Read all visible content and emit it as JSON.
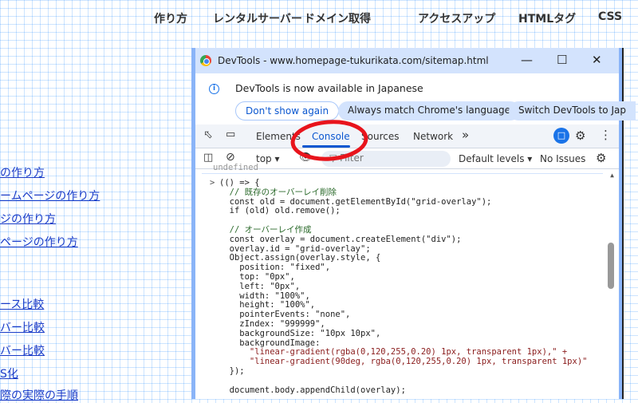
{
  "nav": [
    "作り方",
    "レンタルサーバー",
    "ドメイン取得",
    "アクセスアップ",
    "HTMLタグ",
    "CSS"
  ],
  "links": [
    "の作り方",
    "ームページの作り方",
    "ジの作り方",
    "ページの作り方",
    "ース比較",
    "バー比較",
    "バー比較",
    "S化",
    "際の実際の手順"
  ],
  "devtools": {
    "title": "DevTools - www.homepage-tukurikata.com/sitemap.html",
    "info_text": "DevTools is now available in Japanese",
    "btn_dont_show": "Don't show again",
    "btn_match": "Always match Chrome's language",
    "btn_switch": "Switch DevTools to Jap",
    "tabs": [
      "Elements",
      "Console",
      "Sources",
      "Network"
    ],
    "more_tabs": "»",
    "context": "top",
    "filter_placeholder": "Filter",
    "levels": "Default levels",
    "issues": "No Issues",
    "prev_result": "undefined",
    "code": [
      "(() => {",
      "  // 既存のオーバーレイ削除",
      "  const old = document.getElementById(\"grid-overlay\");",
      "  if (old) old.remove();",
      "",
      "  // オーバーレイ作成",
      "  const overlay = document.createElement(\"div\");",
      "  overlay.id = \"grid-overlay\";",
      "  Object.assign(overlay.style, {",
      "    position: \"fixed\",",
      "    top: \"0px\",",
      "    left: \"0px\",",
      "    width: \"100%\",",
      "    height: \"100%\",",
      "    pointerEvents: \"none\",",
      "    zIndex: \"999999\",",
      "    backgroundSize: \"10px 10px\",",
      "    backgroundImage:",
      "      \"linear-gradient(rgba(0,120,255,0.20) 1px, transparent 1px),\" +",
      "      \"linear-gradient(90deg, rgba(0,120,255,0.20) 1px, transparent 1px)\"",
      "  });",
      "",
      "  document.body.appendChild(overlay);"
    ]
  },
  "annotation_color": "#e8141c"
}
